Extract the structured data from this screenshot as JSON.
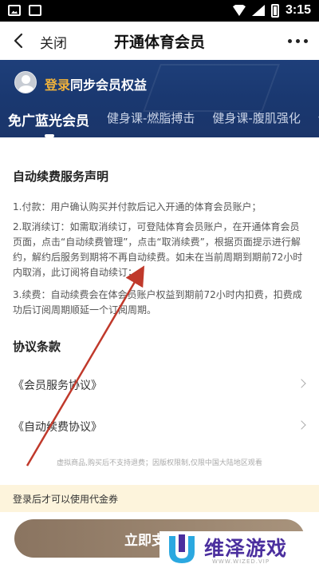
{
  "status_bar": {
    "time": "3:15"
  },
  "nav": {
    "close_label": "关闭",
    "title": "开通体育会员"
  },
  "banner": {
    "login_highlight": "登录",
    "login_rest": "同步会员权益",
    "tabs": [
      "免广蓝光会员",
      "健身课-燃脂搏击",
      "健身课-腹肌强化",
      "健"
    ]
  },
  "declaration": {
    "title": "自动续费服务声明",
    "items": [
      "1.付款：用户确认购买并付款后记入开通的体育会员账户；",
      "2.取消续订：如需取消续订，可登陆体育会员账户，在开通体育会员页面，点击“自动续费管理”，点击“取消续费”，根据页面提示进行解约，解约后服务到期将不再自动续费。如未在当前周期到期前72小时内取消，此订阅将自动续订；",
      "3.续费：自动续费会在体会员账户权益到期前72小时内扣费，扣费成功后订阅周期顺延一个订阅周期。"
    ]
  },
  "agreements": {
    "title": "协议条款",
    "items": [
      "《会员服务协议》",
      "《自动续费协议》"
    ]
  },
  "footnote": "虚拟商品,购买后不支持退费；因版权限制,仅限中国大陆地区观看",
  "coupon_bar": {
    "text": "登录后才可以使用代金券"
  },
  "pay_button": {
    "label": "立即支"
  },
  "watermark": {
    "text": "维泽游戏",
    "sub": "WWW.WIZED.VIP"
  },
  "colors": {
    "banner_blue": "#1e3f7a",
    "gold": "#f0b23b",
    "button_brown": "#8a7460",
    "arrow_red": "#c0392b"
  }
}
